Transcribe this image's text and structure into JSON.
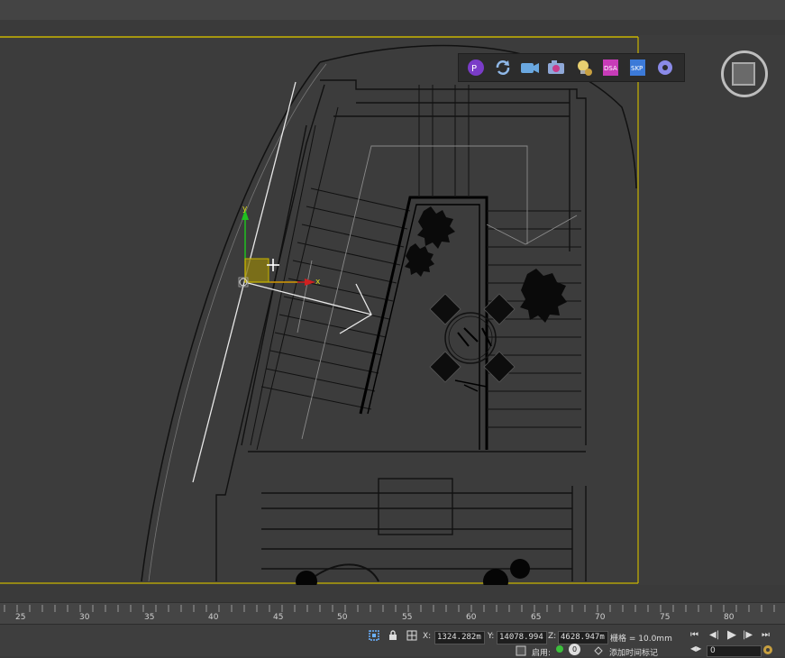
{
  "toolbar": {
    "items": [
      {
        "icon": "render-pause-icon"
      },
      {
        "icon": "refresh-icon"
      },
      {
        "icon": "video-camera-icon"
      },
      {
        "icon": "screenshot-camera-icon"
      },
      {
        "icon": "light-bulb-icon"
      },
      {
        "icon": "export-dsa-icon",
        "label": "DSA"
      },
      {
        "icon": "export-skp-icon",
        "label": "SKP"
      },
      {
        "icon": "settings-gear-icon"
      }
    ]
  },
  "timeline": {
    "ticks": [
      "25",
      "30",
      "35",
      "40",
      "45",
      "50",
      "55",
      "60",
      "65",
      "70",
      "75",
      "80"
    ]
  },
  "status": {
    "x_label": "X:",
    "x_value": "1324.282m",
    "y_label": "Y:",
    "y_value": "14078.994",
    "z_label": "Z:",
    "z_value": "4628.947m",
    "grid_text": "栅格 = 10.0mm",
    "enable_label": "启用:",
    "enable_badge": "0",
    "add_time_tag": "添加时间标记",
    "frame_value": "0"
  },
  "gizmo": {
    "axis_x": "x",
    "axis_y": "y"
  },
  "colors": {
    "viewport_bg": "#3c3c3c",
    "selection_outline": "#c8b400",
    "wire_white": "#e8e8e8",
    "axis_x": "#d02020",
    "axis_y": "#20c020"
  }
}
